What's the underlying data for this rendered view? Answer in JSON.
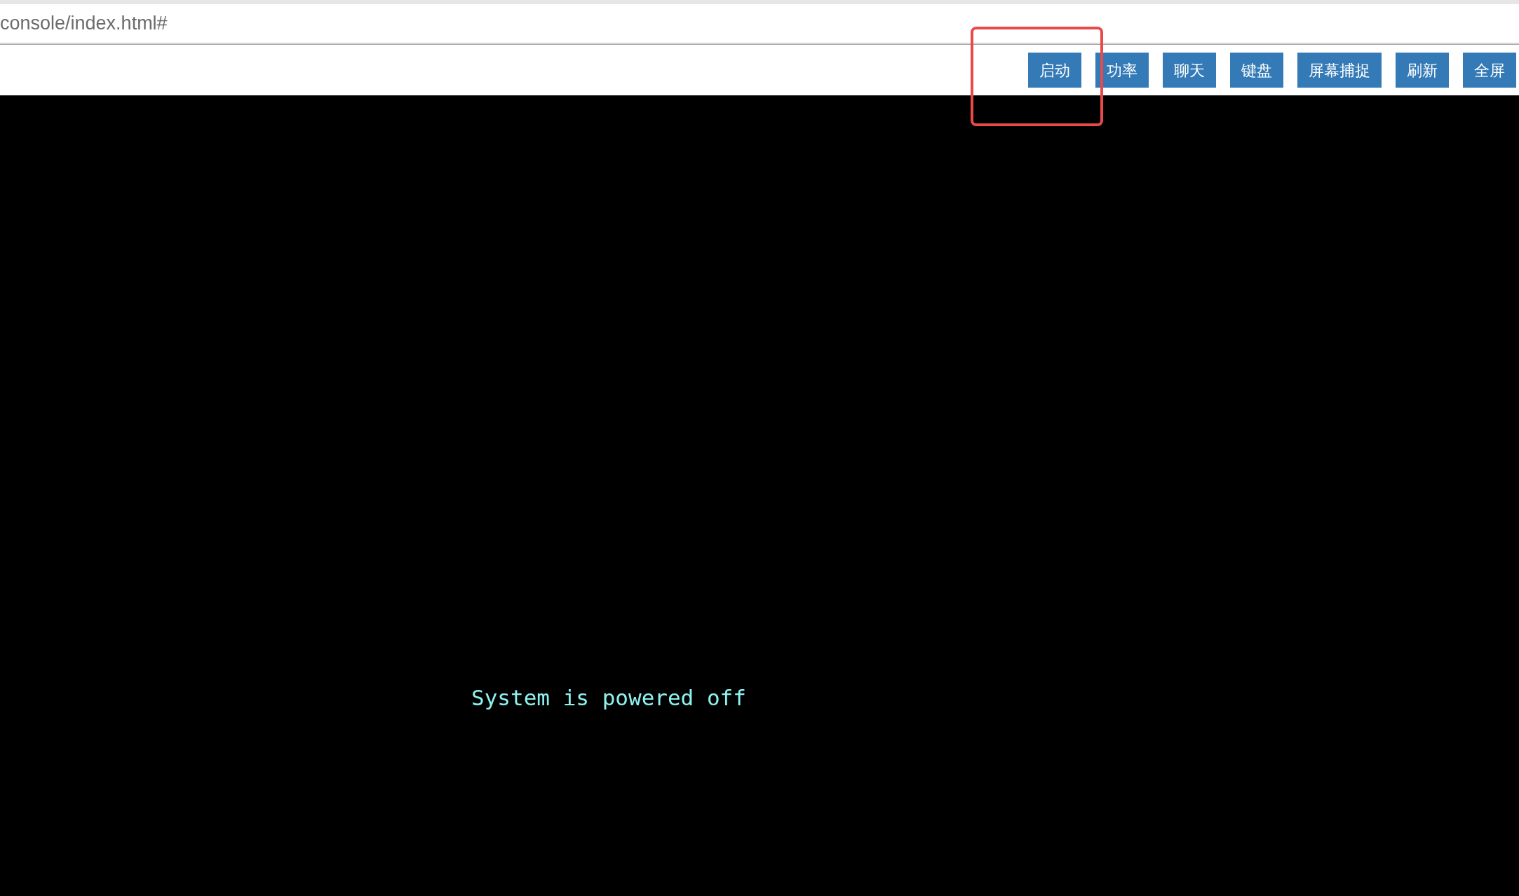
{
  "address_bar": {
    "url": "console/index.html#"
  },
  "toolbar": {
    "buttons": [
      {
        "label": "启动",
        "highlighted": true
      },
      {
        "label": "功率",
        "highlighted": false
      },
      {
        "label": "聊天",
        "highlighted": false
      },
      {
        "label": "键盘",
        "highlighted": false
      },
      {
        "label": "屏幕捕捉",
        "highlighted": false
      },
      {
        "label": "刷新",
        "highlighted": false
      },
      {
        "label": "全屏",
        "highlighted": false
      }
    ]
  },
  "console": {
    "message": "System is powered off"
  }
}
